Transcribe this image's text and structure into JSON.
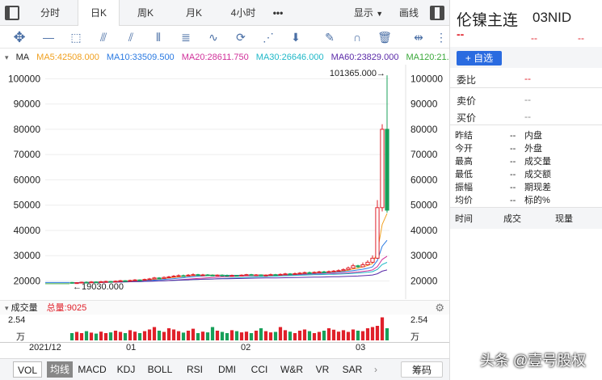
{
  "topbar": {
    "tabs": [
      {
        "label": "分时"
      },
      {
        "label": "日K",
        "active": true
      },
      {
        "label": "周K"
      },
      {
        "label": "月K"
      },
      {
        "label": "4小时"
      },
      {
        "label": "•••"
      }
    ],
    "display_label": "显示",
    "draw_label": "画线"
  },
  "draw_tools": [
    "crosshair-icon",
    "line-segment-icon",
    "rectangle-icon",
    "fan-icon",
    "channel-icon",
    "parallel-lines-icon",
    "fibonacci-icon",
    "wave-icon",
    "cycle-icon",
    "gann-icon",
    "arrow-down-icon",
    "eraser-icon",
    "magnet-icon",
    "trash-icon",
    "expand-icon",
    "lock-icon"
  ],
  "ma": {
    "label": "MA",
    "items": [
      {
        "text": "MA5:42508.000",
        "color": "#f0a020"
      },
      {
        "text": "MA10:33509.500",
        "color": "#2a7ae2"
      },
      {
        "text": "MA20:28611.750",
        "color": "#d0309a"
      },
      {
        "text": "MA30:26646.000",
        "color": "#20b8c8"
      },
      {
        "text": "MA60:23829.000",
        "color": "#5a2aa8"
      },
      {
        "text": "MA120:21...",
        "color": "#3aa83a"
      }
    ]
  },
  "chart": {
    "y_ticks": [
      "100000",
      "90000",
      "80000",
      "70000",
      "60000",
      "50000",
      "40000",
      "30000",
      "20000"
    ],
    "max_label": "101365.000→",
    "min_label": "←19030.000"
  },
  "chart_data": {
    "type": "candlestick",
    "ylim": [
      16000,
      103000
    ],
    "y_ticks": [
      20000,
      30000,
      40000,
      50000,
      60000,
      70000,
      80000,
      90000,
      100000
    ],
    "x_tick_labels": [
      "2021/12",
      "01",
      "02",
      "03"
    ],
    "max_value": 101365,
    "min_value": 19030,
    "candles": [
      [
        19400,
        19200,
        19600,
        19100
      ],
      [
        19200,
        19300,
        19500,
        19030
      ],
      [
        19300,
        19500,
        19700,
        19200
      ],
      [
        19500,
        19400,
        19800,
        19300
      ],
      [
        19400,
        19600,
        19900,
        19300
      ],
      [
        19600,
        19500,
        19800,
        19400
      ],
      [
        19500,
        19700,
        20000,
        19400
      ],
      [
        19700,
        19800,
        20100,
        19600
      ],
      [
        19800,
        19700,
        20000,
        19500
      ],
      [
        19700,
        19900,
        20200,
        19600
      ],
      [
        19900,
        20100,
        20400,
        19800
      ],
      [
        20100,
        20000,
        20300,
        19800
      ],
      [
        20000,
        20200,
        20500,
        19900
      ],
      [
        20200,
        20400,
        20700,
        20100
      ],
      [
        20400,
        20300,
        20600,
        20100
      ],
      [
        20300,
        20600,
        20900,
        20200
      ],
      [
        20600,
        20800,
        21200,
        20500
      ],
      [
        20800,
        21200,
        21600,
        20700
      ],
      [
        21200,
        21000,
        21500,
        20800
      ],
      [
        21000,
        21400,
        21800,
        20900
      ],
      [
        21400,
        21600,
        22000,
        21200
      ],
      [
        21600,
        21900,
        22300,
        21500
      ],
      [
        21900,
        22100,
        22600,
        21700
      ],
      [
        22100,
        22000,
        22500,
        21800
      ],
      [
        22000,
        22300,
        22700,
        21900
      ],
      [
        22300,
        22500,
        23000,
        22100
      ],
      [
        22500,
        22200,
        22800,
        22000
      ],
      [
        22200,
        22400,
        22800,
        22000
      ],
      [
        22400,
        22300,
        22700,
        22100
      ],
      [
        22300,
        22100,
        22600,
        21900
      ],
      [
        22100,
        22300,
        22600,
        21900
      ],
      [
        22300,
        22200,
        22600,
        22000
      ],
      [
        22200,
        22000,
        22500,
        21800
      ],
      [
        22000,
        22200,
        22500,
        21900
      ],
      [
        22200,
        22100,
        22400,
        21900
      ],
      [
        22100,
        22300,
        22600,
        21900
      ],
      [
        22300,
        22500,
        22800,
        22100
      ],
      [
        22500,
        22300,
        22800,
        22100
      ],
      [
        22300,
        22400,
        22700,
        22100
      ],
      [
        22400,
        22200,
        22600,
        22000
      ],
      [
        22200,
        22300,
        22600,
        22000
      ],
      [
        22300,
        22500,
        22900,
        22100
      ],
      [
        22500,
        22400,
        22800,
        22200
      ],
      [
        22400,
        22600,
        23000,
        22200
      ],
      [
        22600,
        22800,
        23200,
        22400
      ],
      [
        22800,
        22700,
        23100,
        22500
      ],
      [
        22700,
        22900,
        23300,
        22500
      ],
      [
        22900,
        23100,
        23500,
        22700
      ],
      [
        23100,
        23300,
        23700,
        22900
      ],
      [
        23300,
        23200,
        23700,
        23000
      ],
      [
        23200,
        23400,
        23800,
        23000
      ],
      [
        23400,
        23600,
        24000,
        23200
      ],
      [
        23600,
        23500,
        24000,
        23300
      ],
      [
        23500,
        23700,
        24100,
        23300
      ],
      [
        23700,
        23900,
        24300,
        23500
      ],
      [
        23900,
        24100,
        24600,
        23700
      ],
      [
        24100,
        24500,
        25000,
        23900
      ],
      [
        24500,
        25100,
        25700,
        24300
      ],
      [
        25100,
        26000,
        26800,
        24900
      ],
      [
        26000,
        25600,
        26400,
        25200
      ],
      [
        25600,
        26400,
        27300,
        25400
      ],
      [
        26400,
        27400,
        28200,
        26200
      ],
      [
        27400,
        29000,
        30100,
        27000
      ],
      [
        29000,
        49000,
        52000,
        28800
      ],
      [
        49000,
        80000,
        82000,
        47500
      ],
      [
        80000,
        48000,
        101365,
        47000
      ]
    ]
  },
  "volume": {
    "label": "成交量",
    "total_label": "总量:9025",
    "y_top": "2.54",
    "y_unit": "万",
    "bars": [
      0.3,
      0.35,
      0.3,
      0.38,
      0.32,
      0.28,
      0.36,
      0.3,
      0.33,
      0.4,
      0.35,
      0.3,
      0.42,
      0.36,
      0.3,
      0.38,
      0.45,
      0.55,
      0.4,
      0.35,
      0.5,
      0.45,
      0.38,
      0.32,
      0.4,
      0.48,
      0.3,
      0.36,
      0.33,
      0.55,
      0.4,
      0.35,
      0.3,
      0.42,
      0.38,
      0.33,
      0.36,
      0.3,
      0.4,
      0.5,
      0.38,
      0.33,
      0.35,
      0.55,
      0.42,
      0.36,
      0.3,
      0.4,
      0.45,
      0.38,
      0.3,
      0.35,
      0.4,
      0.5,
      0.44,
      0.36,
      0.42,
      0.35,
      0.45,
      0.4,
      0.38,
      0.5,
      0.55,
      0.6,
      0.95,
      0.5
    ]
  },
  "date_axis": [
    "2021/12",
    "01",
    "02",
    "03"
  ],
  "indicators": [
    {
      "label": "VOL",
      "active": true
    },
    {
      "label": "均线",
      "active": true
    },
    {
      "label": "MACD"
    },
    {
      "label": "KDJ"
    },
    {
      "label": "BOLL"
    },
    {
      "label": "RSI"
    },
    {
      "label": "DMI"
    },
    {
      "label": "CCI"
    },
    {
      "label": "W&R"
    },
    {
      "label": "VR"
    },
    {
      "label": "SAR"
    }
  ],
  "chip_label": "筹码",
  "right_panel": {
    "name": "伦镍主连",
    "code": "03NID",
    "dashes": "--",
    "add_watch": "+ 自选",
    "weibi": "委比",
    "sell": "卖价",
    "buy": "买价",
    "stats": [
      {
        "label": "昨结",
        "value": "--",
        "label2": "内盘"
      },
      {
        "label": "今开",
        "value": "--",
        "label2": "外盘"
      },
      {
        "label": "最高",
        "value": "--",
        "label2": "成交量"
      },
      {
        "label": "最低",
        "value": "--",
        "label2": "成交额"
      },
      {
        "label": "振幅",
        "value": "--",
        "label2": "期现差"
      },
      {
        "label": "均价",
        "value": "--",
        "label2": "标的%"
      }
    ],
    "trade_headers": [
      "时间",
      "成交",
      "现量"
    ]
  },
  "watermark": "头条 @壹号股权"
}
